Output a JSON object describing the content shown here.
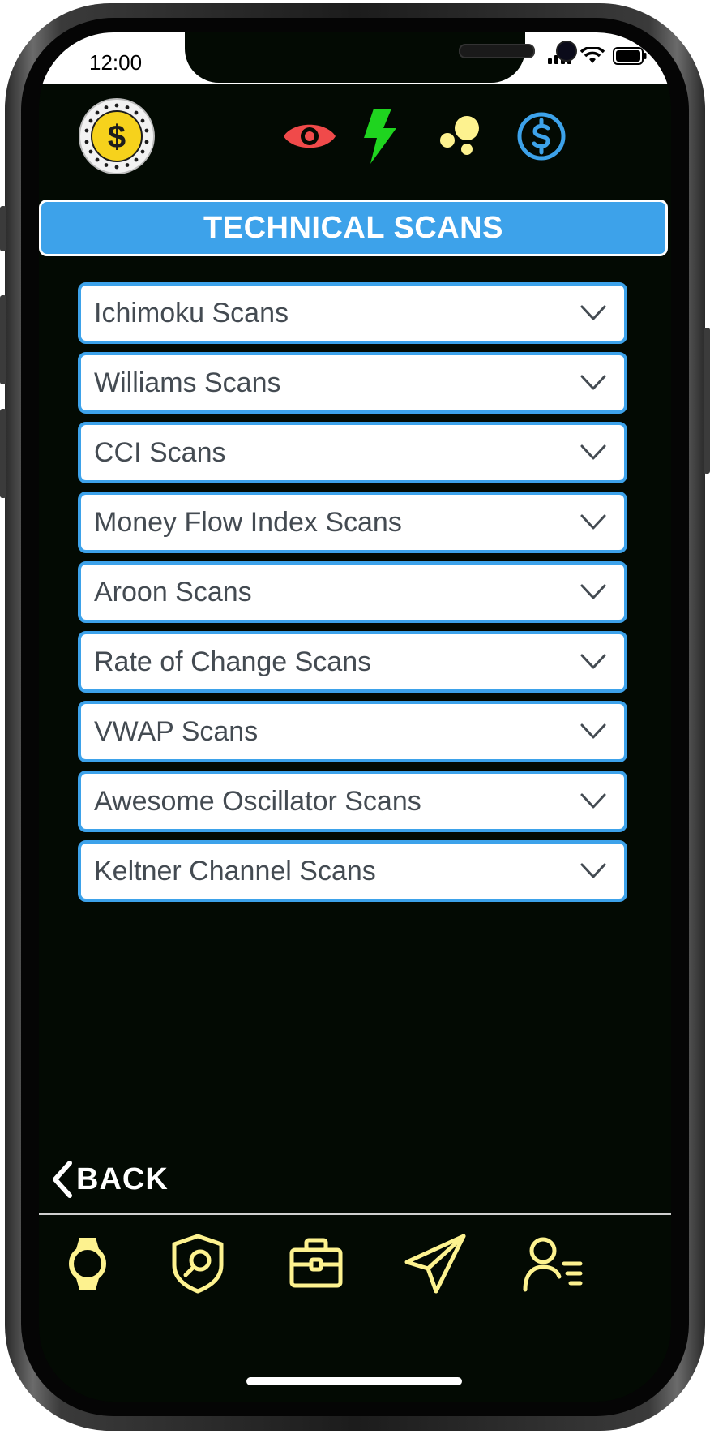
{
  "status_bar": {
    "time": "12:00"
  },
  "header": {
    "title": "TECHNICAL SCANS",
    "icons": [
      "dollar-coin-icon",
      "eye-icon",
      "lightning-icon",
      "bubbles-icon",
      "dollar-circle-icon"
    ]
  },
  "scans": [
    {
      "label": "Ichimoku Scans"
    },
    {
      "label": "Williams Scans"
    },
    {
      "label": "CCI Scans"
    },
    {
      "label": "Money Flow Index Scans"
    },
    {
      "label": "Aroon Scans"
    },
    {
      "label": "Rate of Change Scans"
    },
    {
      "label": "VWAP Scans"
    },
    {
      "label": "Awesome Oscillator Scans"
    },
    {
      "label": "Keltner Channel Scans"
    }
  ],
  "back": {
    "label": "BACK"
  },
  "tabbar": {
    "icons": [
      "watch-icon",
      "shield-search-icon",
      "briefcase-icon",
      "paper-plane-icon",
      "user-list-icon"
    ]
  },
  "colors": {
    "accent_blue": "#3da2ea",
    "tab_yellow": "#fdf28f",
    "eye_red": "#f04a4a",
    "lightning_green": "#1fd41f",
    "coin_yellow": "#f6d21c",
    "background": "#030a03"
  }
}
